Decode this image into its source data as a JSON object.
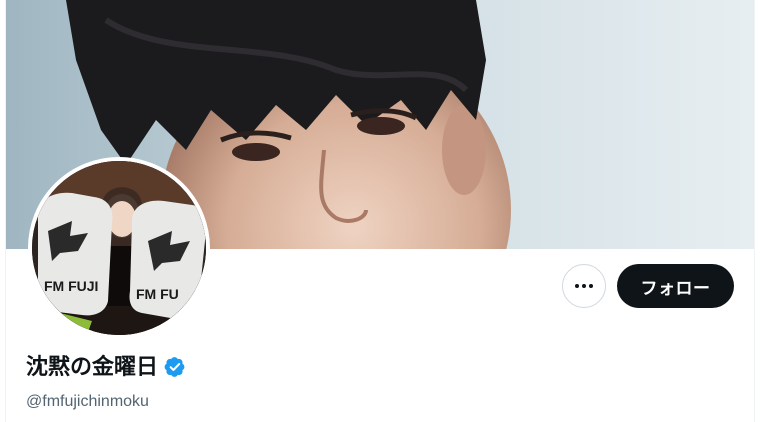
{
  "profile": {
    "display_name": "沈黙の金曜日",
    "handle": "@fmfujichinmoku",
    "verified": true,
    "accent_color": "#1d9bf0"
  },
  "actions": {
    "more_icon": "more-horizontal-icon",
    "follow_label": "フォロー"
  },
  "avatar": {
    "logo_text_left": "FM FUJI",
    "logo_text_right": "FM FU"
  },
  "colors": {
    "follow_bg": "#0f1419",
    "name_color": "#0f1419",
    "handle_color": "#536471"
  }
}
